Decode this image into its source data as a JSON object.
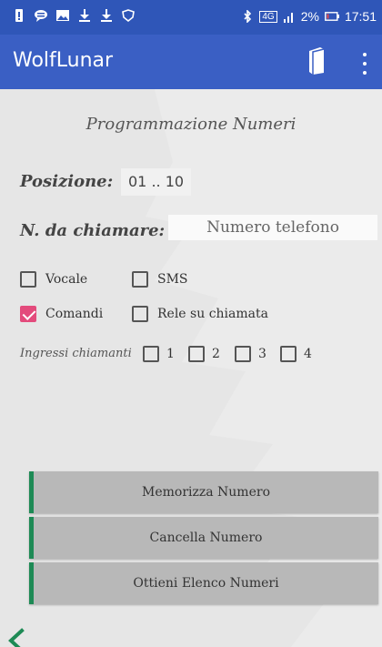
{
  "status_bar": {
    "left_icons": [
      "alert-icon",
      "message-icon",
      "image-icon",
      "download-icon",
      "download-icon",
      "shield-icon"
    ],
    "bluetooth": "bluetooth-icon",
    "network": "4G",
    "battery": "2%",
    "time": "17:51"
  },
  "app_bar": {
    "title": "WolfLunar",
    "book_icon": "book-icon",
    "menu_icon": "overflow-menu-icon"
  },
  "form": {
    "heading": "Programmazione Numeri",
    "position_label": "Posizione:",
    "position_value": "01 .. 10",
    "number_label": "N. da chiamare:",
    "number_placeholder": "Numero telefono",
    "number_value": ""
  },
  "checkboxes": {
    "vocale": {
      "label": "Vocale",
      "checked": false
    },
    "sms": {
      "label": "SMS",
      "checked": false
    },
    "comandi": {
      "label": "Comandi",
      "checked": true
    },
    "rele": {
      "label": "Rele su chiamata",
      "checked": false
    }
  },
  "ingressi": {
    "label": "Ingressi chiamanti",
    "items": [
      {
        "label": "1",
        "checked": false
      },
      {
        "label": "2",
        "checked": false
      },
      {
        "label": "3",
        "checked": false
      },
      {
        "label": "4",
        "checked": false
      }
    ]
  },
  "buttons": {
    "memorize": "Memorizza Numero",
    "delete": "Cancella Numero",
    "list": "Ottieni Elenco Numeri"
  },
  "colors": {
    "status_bar": "#2f56b8",
    "app_bar": "#3a5fc4",
    "checked": "#e34b7c",
    "button_accent": "#1e8a55",
    "back_arrow": "#1e8a55"
  }
}
